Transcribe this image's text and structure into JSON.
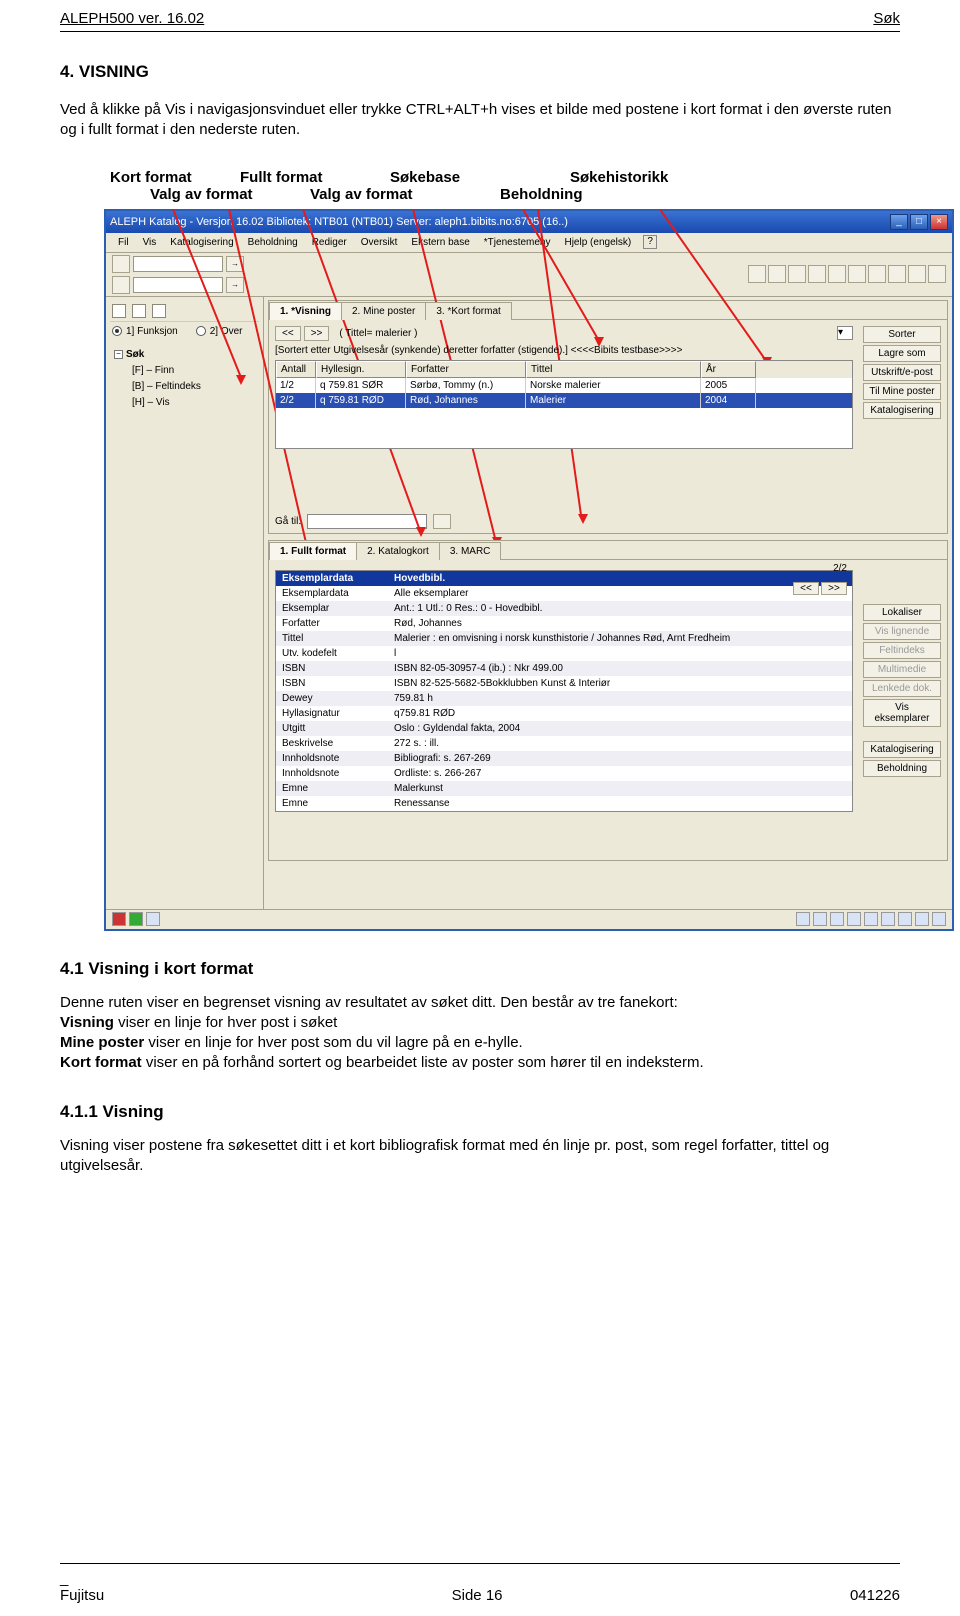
{
  "header": {
    "left": "ALEPH500 ver. 16.02",
    "right": "Søk"
  },
  "section": {
    "title": "4. VISNING",
    "intro": "Ved å klikke på Vis i navigasjonsvinduet eller trykke CTRL+ALT+h vises et bilde med postene i kort format i den øverste ruten og i fullt format i den nederste ruten."
  },
  "annotations": {
    "row1": {
      "a": "Kort format",
      "b": "Fullt format",
      "c": "Søkebase",
      "d": "Søkehistorikk"
    },
    "row2": {
      "a": "Valg av format",
      "b": "Valg av format",
      "c": "Beholdning"
    }
  },
  "app": {
    "title": "ALEPH Katalog - Versjon 16.02        Bibliotek: NTB01 (NTB01)        Server: aleph1.bibits.no:6705 (16..)",
    "menu": [
      "Fil",
      "Vis",
      "Katalogisering",
      "Beholdning",
      "Rediger",
      "Oversikt",
      "Ekstern base",
      "*Tjenestemeny",
      "Hjelp (engelsk)"
    ],
    "nav": {
      "radios": [
        "1] Funksjon",
        "2] Over"
      ],
      "tree_root": "Søk",
      "tree_children": [
        "[F] – Finn",
        "[B] – Feltindeks",
        "[H] – Vis"
      ]
    },
    "pane_top": {
      "tabs": [
        "1. *Visning",
        "2. Mine poster",
        "3. *Kort format"
      ],
      "nav_prev": "<<",
      "nav_next": ">>",
      "query": "( Tittel= malerier )",
      "sort": "[Sortert etter Utgivelsesår (synkende) deretter forfatter (stigende).]   <<<<Bibits testbase>>>>",
      "headers": [
        "Antall",
        "Hyllesign.",
        "Forfatter",
        "Tittel",
        "År"
      ],
      "rows": [
        {
          "n": "1/2",
          "h": "q 759.81 SØR",
          "f": "Sørbø, Tommy (n.)",
          "t": "Norske malerier",
          "y": "2005"
        },
        {
          "n": "2/2",
          "h": "q 759.81 RØD",
          "f": "Rød, Johannes",
          "t": "Malerier",
          "y": "2004"
        }
      ],
      "side": [
        "Sorter",
        "Lagre som",
        "Utskrift/e-post",
        "Til Mine poster",
        "Katalogisering"
      ],
      "goto": "Gå til:"
    },
    "pane_bottom": {
      "tabs": [
        "1. Fullt format",
        "2. Katalogkort",
        "3. MARC"
      ],
      "page": "2/2",
      "prev": "<<",
      "next": ">>",
      "headers": [
        "Eksemplardata",
        "Hovedbibl."
      ],
      "rows": [
        [
          "Eksemplardata",
          "Alle eksemplarer"
        ],
        [
          "Eksemplar",
          "Ant.: 1 Utl.: 0 Res.: 0 - Hovedbibl."
        ],
        [
          "Forfatter",
          "Rød, Johannes"
        ],
        [
          "Tittel",
          "Malerier : en omvisning i norsk kunsthistorie / Johannes Rød, Arnt Fredheim"
        ],
        [
          "Utv. kodefelt",
          "l"
        ],
        [
          "ISBN",
          "ISBN 82-05-30957-4 (ib.) : Nkr 499.00"
        ],
        [
          "ISBN",
          "ISBN 82-525-5682-5Bokklubben Kunst & Interiør"
        ],
        [
          "Dewey",
          "759.81 h"
        ],
        [
          "Hyllasignatur",
          "q759.81 RØD"
        ],
        [
          "Utgitt",
          "Oslo : Gyldendal fakta, 2004"
        ],
        [
          "Beskrivelse",
          "272 s. : ill."
        ],
        [
          "Innholdsnote",
          "Bibliografi: s. 267-269"
        ],
        [
          "Innholdsnote",
          "Ordliste: s. 266-267"
        ],
        [
          "Emne",
          "Malerkunst"
        ],
        [
          "Emne",
          "Renessanse"
        ]
      ],
      "side": [
        "Lokaliser",
        "Vis lignende",
        "Feltindeks",
        "Multimedie",
        "Lenkede dok.",
        "Vis eksemplarer",
        "Katalogisering",
        "Beholdning"
      ]
    }
  },
  "sub1": {
    "title": "4.1 Visning i kort format",
    "p1a": "Denne ruten viser en begrenset visning av resultatet av søket ditt. Den består av tre fanekort:",
    "vis_label": "Visning",
    "vis_text": " viser en linje for hver post i søket",
    "mine_label": "Mine poster",
    "mine_text": " viser en linje for hver post som du vil lagre på en e-hylle.",
    "kort_label": "Kort format",
    "kort_text": " viser en på forhånd sortert og bearbeidet liste av poster som hører til en indeksterm."
  },
  "sub2": {
    "title": "4.1.1 Visning",
    "p": "Visning viser postene fra søkesettet ditt i et kort bibliografisk format med én linje pr. post, som regel forfatter, tittel og utgivelsesår."
  },
  "footer": {
    "left": "Fujitsu",
    "center": "Side 16",
    "right": "041226",
    "dash": "_"
  }
}
